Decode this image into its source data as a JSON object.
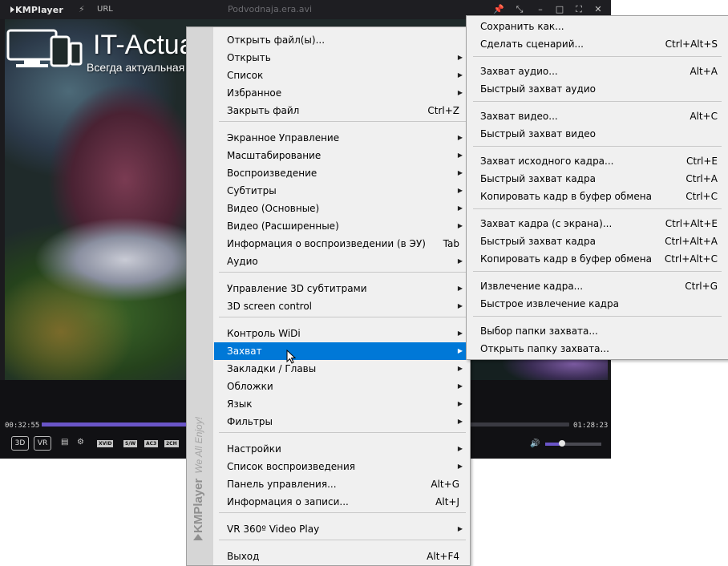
{
  "player": {
    "app_name": "KMPlayer",
    "url_label": "URL",
    "file_title": "Podvodnaja.era.avi",
    "time_elapsed": "00:32:55",
    "time_total": "01:28:23",
    "seek_progress": 0.37,
    "volume_level": 0.3,
    "btn_3d": "3D",
    "btn_vr": "VR",
    "chips": [
      "XVID",
      "S/W",
      "AC3",
      "2CH"
    ],
    "accent_color": "#6a55c8"
  },
  "watermark": {
    "brand": "IT-Actual.ru",
    "tagline": "Всегда актуальная информация"
  },
  "menu_main": {
    "side_brand": "KMPlayer",
    "side_slogan": "We All Enjoy!",
    "highlight_color": "#0078d7",
    "items": [
      {
        "label": "Открыть файл(ы)...",
        "shortcut": "",
        "submenu": false
      },
      {
        "label": "Открыть",
        "shortcut": "",
        "submenu": true
      },
      {
        "label": "Список",
        "shortcut": "",
        "submenu": true
      },
      {
        "label": "Избранное",
        "shortcut": "",
        "submenu": true
      },
      {
        "label": "Закрыть файл",
        "shortcut": "Ctrl+Z",
        "submenu": false
      },
      {
        "label": "Экранное Управление",
        "shortcut": "",
        "submenu": true
      },
      {
        "label": "Масштабирование",
        "shortcut": "",
        "submenu": true
      },
      {
        "label": "Воспроизведение",
        "shortcut": "",
        "submenu": true
      },
      {
        "label": "Субтитры",
        "shortcut": "",
        "submenu": true
      },
      {
        "label": "Видео (Основные)",
        "shortcut": "",
        "submenu": true
      },
      {
        "label": "Видео (Расширенные)",
        "shortcut": "",
        "submenu": true
      },
      {
        "label": "Информация о воспроизведении (в ЭУ)",
        "shortcut": "Tab",
        "submenu": false
      },
      {
        "label": "Аудио",
        "shortcut": "",
        "submenu": true
      },
      {
        "label": "Управление 3D субтитрами",
        "shortcut": "",
        "submenu": true
      },
      {
        "label": "3D screen control",
        "shortcut": "",
        "submenu": true
      },
      {
        "label": "Контроль WiDi",
        "shortcut": "",
        "submenu": true
      },
      {
        "label": "Захват",
        "shortcut": "",
        "submenu": true
      },
      {
        "label": "Закладки / Главы",
        "shortcut": "",
        "submenu": true
      },
      {
        "label": "Обложки",
        "shortcut": "",
        "submenu": true
      },
      {
        "label": "Язык",
        "shortcut": "",
        "submenu": true
      },
      {
        "label": "Фильтры",
        "shortcut": "",
        "submenu": true
      },
      {
        "label": "Настройки",
        "shortcut": "",
        "submenu": true
      },
      {
        "label": "Список воспроизведения",
        "shortcut": "",
        "submenu": true
      },
      {
        "label": "Панель управления...",
        "shortcut": "Alt+G",
        "submenu": false
      },
      {
        "label": "Информация о записи...",
        "shortcut": "Alt+J",
        "submenu": false
      },
      {
        "label": "VR 360º Video Play",
        "shortcut": "",
        "submenu": true
      },
      {
        "label": "Выход",
        "shortcut": "Alt+F4",
        "submenu": false
      }
    ]
  },
  "menu_capture": {
    "items": [
      {
        "label": "Сохранить как...",
        "shortcut": ""
      },
      {
        "label": "Сделать сценарий...",
        "shortcut": "Ctrl+Alt+S"
      },
      {
        "label": "Захват аудио...",
        "shortcut": "Alt+A"
      },
      {
        "label": "Быстрый захват аудио",
        "shortcut": ""
      },
      {
        "label": "Захват видео...",
        "shortcut": "Alt+C"
      },
      {
        "label": "Быстрый захват видео",
        "shortcut": ""
      },
      {
        "label": "Захват исходного кадра...",
        "shortcut": "Ctrl+E"
      },
      {
        "label": "Быстрый захват кадра",
        "shortcut": "Ctrl+A"
      },
      {
        "label": "Копировать кадр в буфер обмена",
        "shortcut": "Ctrl+C"
      },
      {
        "label": "Захват кадра (с экрана)...",
        "shortcut": "Ctrl+Alt+E"
      },
      {
        "label": "Быстрый захват кадра",
        "shortcut": "Ctrl+Alt+A"
      },
      {
        "label": "Копировать кадр в буфер обмена",
        "shortcut": "Ctrl+Alt+C"
      },
      {
        "label": "Извлечение кадра...",
        "shortcut": "Ctrl+G"
      },
      {
        "label": "Быстрое извлечение кадра",
        "shortcut": ""
      },
      {
        "label": "Выбор папки захвата...",
        "shortcut": ""
      },
      {
        "label": "Открыть папку захвата...",
        "shortcut": ""
      }
    ]
  }
}
